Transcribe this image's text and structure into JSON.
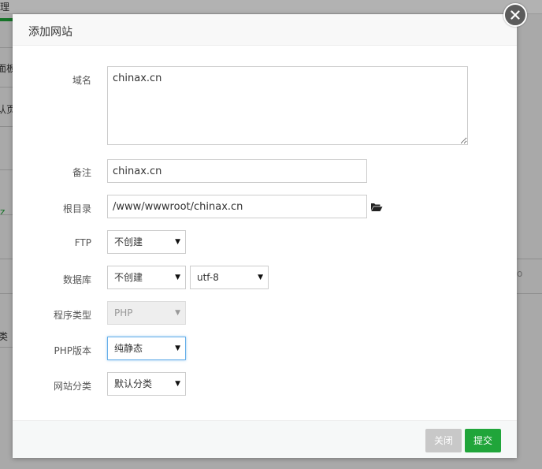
{
  "background": {
    "frag_top": "理",
    "frag_2": "面板",
    "frag_3": "认页",
    "frag_4": "z",
    "frag_5": "类",
    "frag_right": "o"
  },
  "modal": {
    "title": "添加网站",
    "fields": {
      "domain": {
        "label": "域名",
        "value": "chinax.cn"
      },
      "remark": {
        "label": "备注",
        "value": "chinax.cn"
      },
      "root": {
        "label": "根目录",
        "value": "/www/wwwroot/chinax.cn"
      },
      "ftp": {
        "label": "FTP",
        "selected": "不创建"
      },
      "database": {
        "label": "数据库",
        "selected": "不创建",
        "charset": "utf-8"
      },
      "program_type": {
        "label": "程序类型",
        "selected": "PHP"
      },
      "php_version": {
        "label": "PHP版本",
        "selected": "纯静态"
      },
      "category": {
        "label": "网站分类",
        "selected": "默认分类"
      }
    },
    "buttons": {
      "close": "关闭",
      "submit": "提交"
    }
  },
  "colors": {
    "accent": "#20a53a",
    "close_button": "#c8c8c8",
    "close_icon_bg": "#5c5c5c",
    "focus_border": "#66afe9"
  },
  "icons": {
    "close": "close-icon",
    "folder": "folder-open-icon",
    "caret": "caret-down-icon"
  }
}
